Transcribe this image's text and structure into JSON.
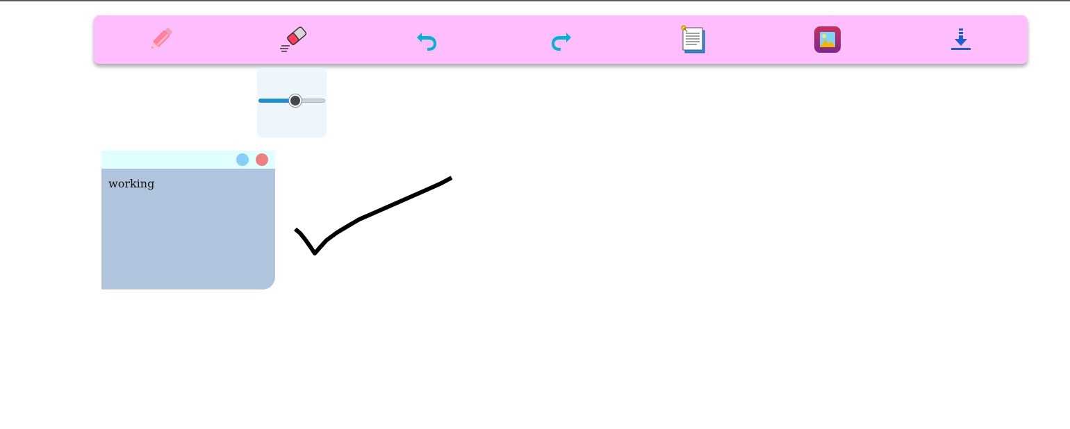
{
  "toolbar": {
    "tools": [
      {
        "name": "pen",
        "icon": "pen-icon"
      },
      {
        "name": "eraser",
        "icon": "eraser-icon"
      },
      {
        "name": "undo",
        "icon": "undo-icon"
      },
      {
        "name": "redo",
        "icon": "redo-icon"
      },
      {
        "name": "add-note",
        "icon": "sticky-note-icon"
      },
      {
        "name": "add-image",
        "icon": "image-icon"
      },
      {
        "name": "download",
        "icon": "download-icon"
      }
    ],
    "background_color": "#febefe",
    "accent_color": "#00b4d8"
  },
  "size_slider": {
    "value_fraction": 0.55,
    "fill_color": "#1f8fd0"
  },
  "note": {
    "text": "working",
    "header_color": "#e0ffff",
    "body_color": "#b0c4de",
    "buttons": [
      {
        "name": "color",
        "color": "#87cefa"
      },
      {
        "name": "close",
        "color": "#f08080"
      }
    ]
  },
  "canvas": {
    "stroke_color": "#000000",
    "stroke_description_icon": "checkmark-stroke"
  }
}
